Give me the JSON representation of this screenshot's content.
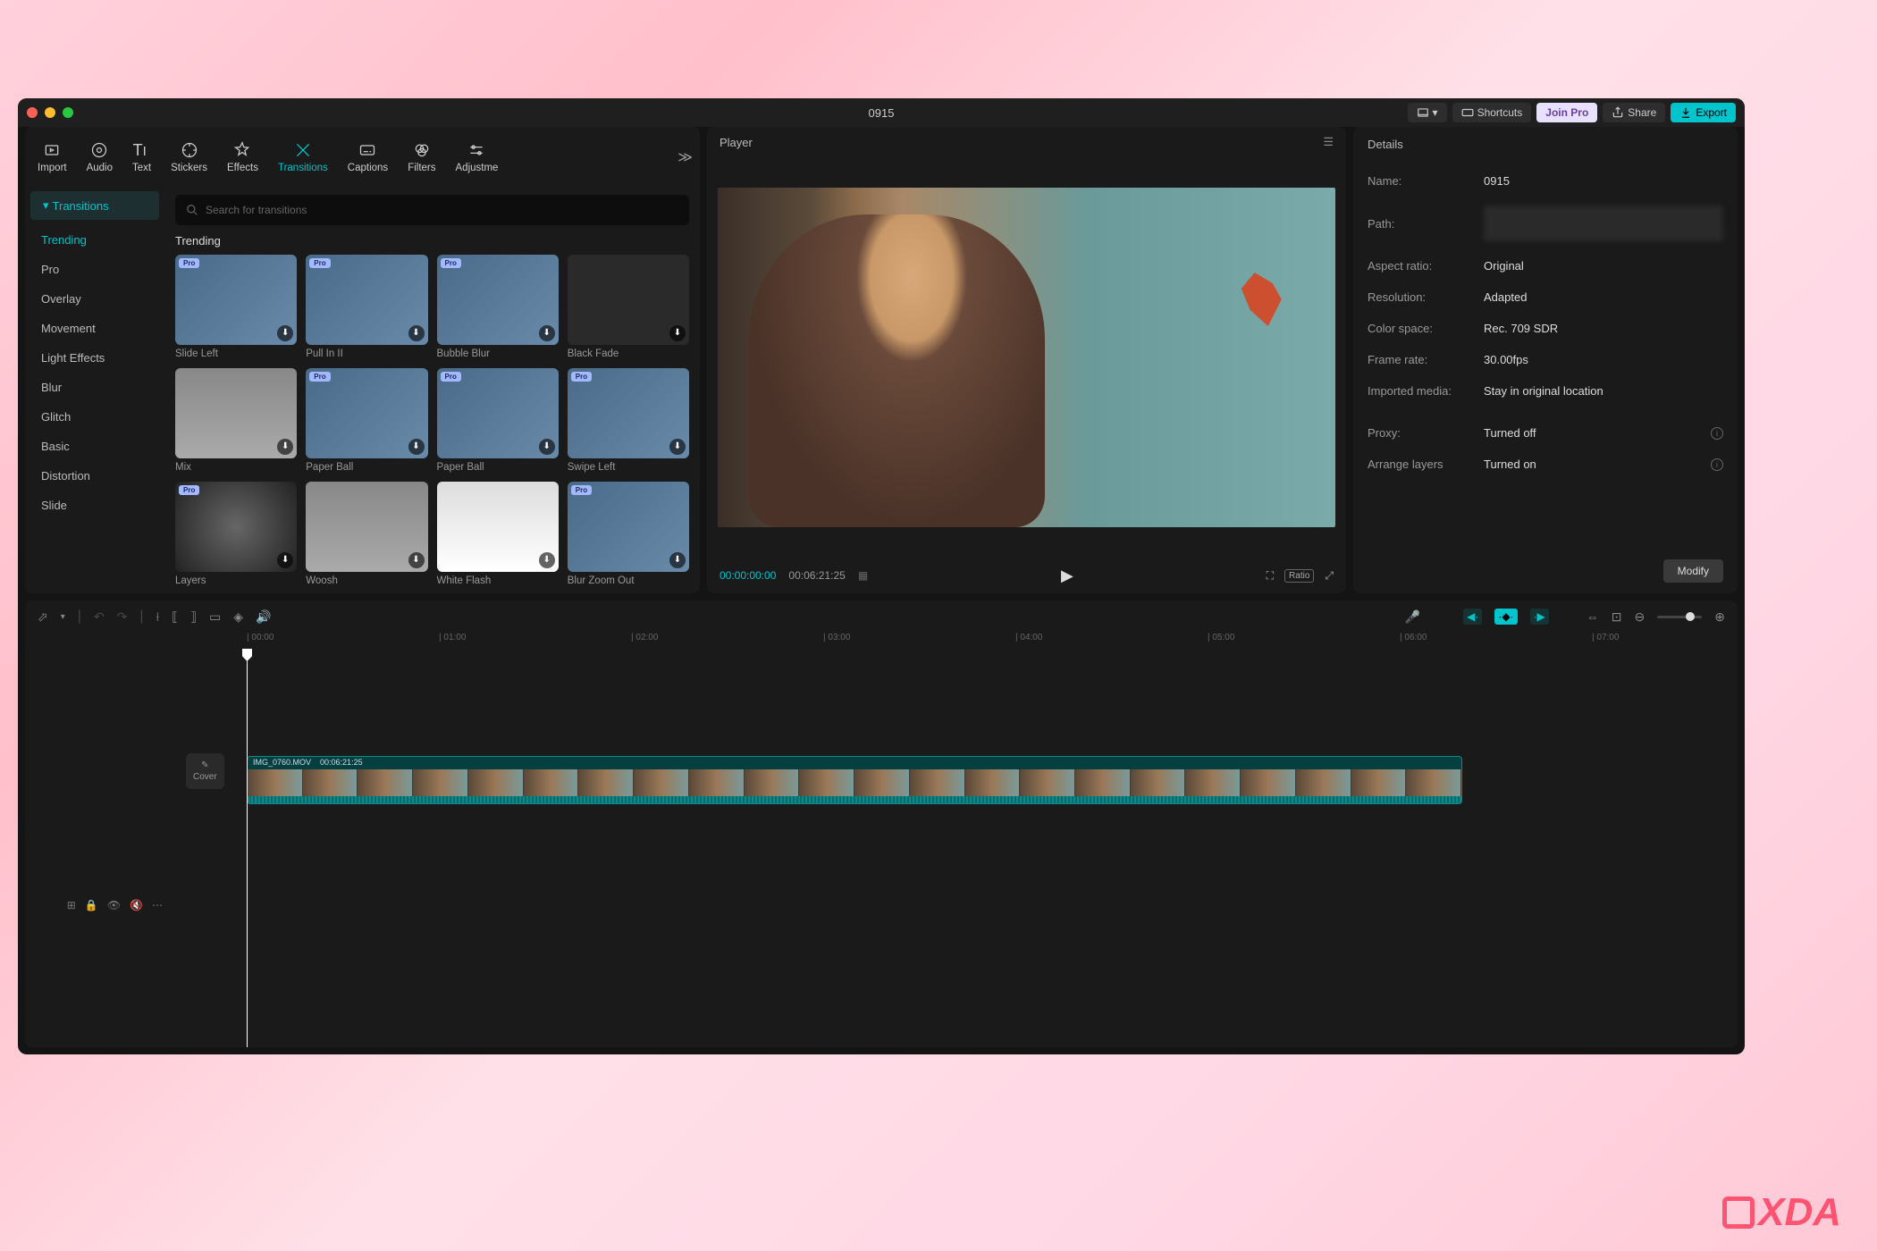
{
  "title": "0915",
  "titlebar": {
    "shortcuts": "Shortcuts",
    "join_pro": "Join Pro",
    "share": "Share",
    "export": "Export"
  },
  "top_tabs": [
    {
      "label": "Import"
    },
    {
      "label": "Audio"
    },
    {
      "label": "Text"
    },
    {
      "label": "Stickers"
    },
    {
      "label": "Effects"
    },
    {
      "label": "Transitions"
    },
    {
      "label": "Captions"
    },
    {
      "label": "Filters"
    },
    {
      "label": "Adjustme"
    }
  ],
  "sidebar": {
    "header": "Transitions",
    "items": [
      "Trending",
      "Pro",
      "Overlay",
      "Movement",
      "Light Effects",
      "Blur",
      "Glitch",
      "Basic",
      "Distortion",
      "Slide"
    ]
  },
  "search_placeholder": "Search for transitions",
  "section_title": "Trending",
  "cards": [
    {
      "label": "Slide Left",
      "pro": true
    },
    {
      "label": "Pull In II",
      "pro": true
    },
    {
      "label": "Bubble Blur",
      "pro": true
    },
    {
      "label": "Black Fade",
      "pro": false
    },
    {
      "label": "Mix",
      "pro": false
    },
    {
      "label": "Paper Ball",
      "pro": true
    },
    {
      "label": "Paper Ball",
      "pro": true
    },
    {
      "label": "Swipe Left",
      "pro": true
    },
    {
      "label": "Layers",
      "pro": true
    },
    {
      "label": "Woosh",
      "pro": false
    },
    {
      "label": "White Flash",
      "pro": false
    },
    {
      "label": "Blur Zoom Out",
      "pro": true
    }
  ],
  "player": {
    "header": "Player",
    "current_time": "00:00:00:00",
    "total_time": "00:06:21:25",
    "ratio_label": "Ratio"
  },
  "details": {
    "title": "Details",
    "name_label": "Name:",
    "name_value": "0915",
    "path_label": "Path:",
    "aspect_label": "Aspect ratio:",
    "aspect_value": "Original",
    "resolution_label": "Resolution:",
    "resolution_value": "Adapted",
    "colorspace_label": "Color space:",
    "colorspace_value": "Rec. 709 SDR",
    "framerate_label": "Frame rate:",
    "framerate_value": "30.00fps",
    "imported_label": "Imported media:",
    "imported_value": "Stay in original location",
    "proxy_label": "Proxy:",
    "proxy_value": "Turned off",
    "layers_label": "Arrange layers",
    "layers_value": "Turned on",
    "modify": "Modify"
  },
  "timeline": {
    "ruler": [
      "00:00",
      "01:00",
      "02:00",
      "03:00",
      "04:00",
      "05:00",
      "06:00",
      "07:00"
    ],
    "clip_name": "IMG_0760.MOV",
    "clip_duration": "00:06:21:25",
    "cover": "Cover"
  },
  "watermark": "XDA"
}
